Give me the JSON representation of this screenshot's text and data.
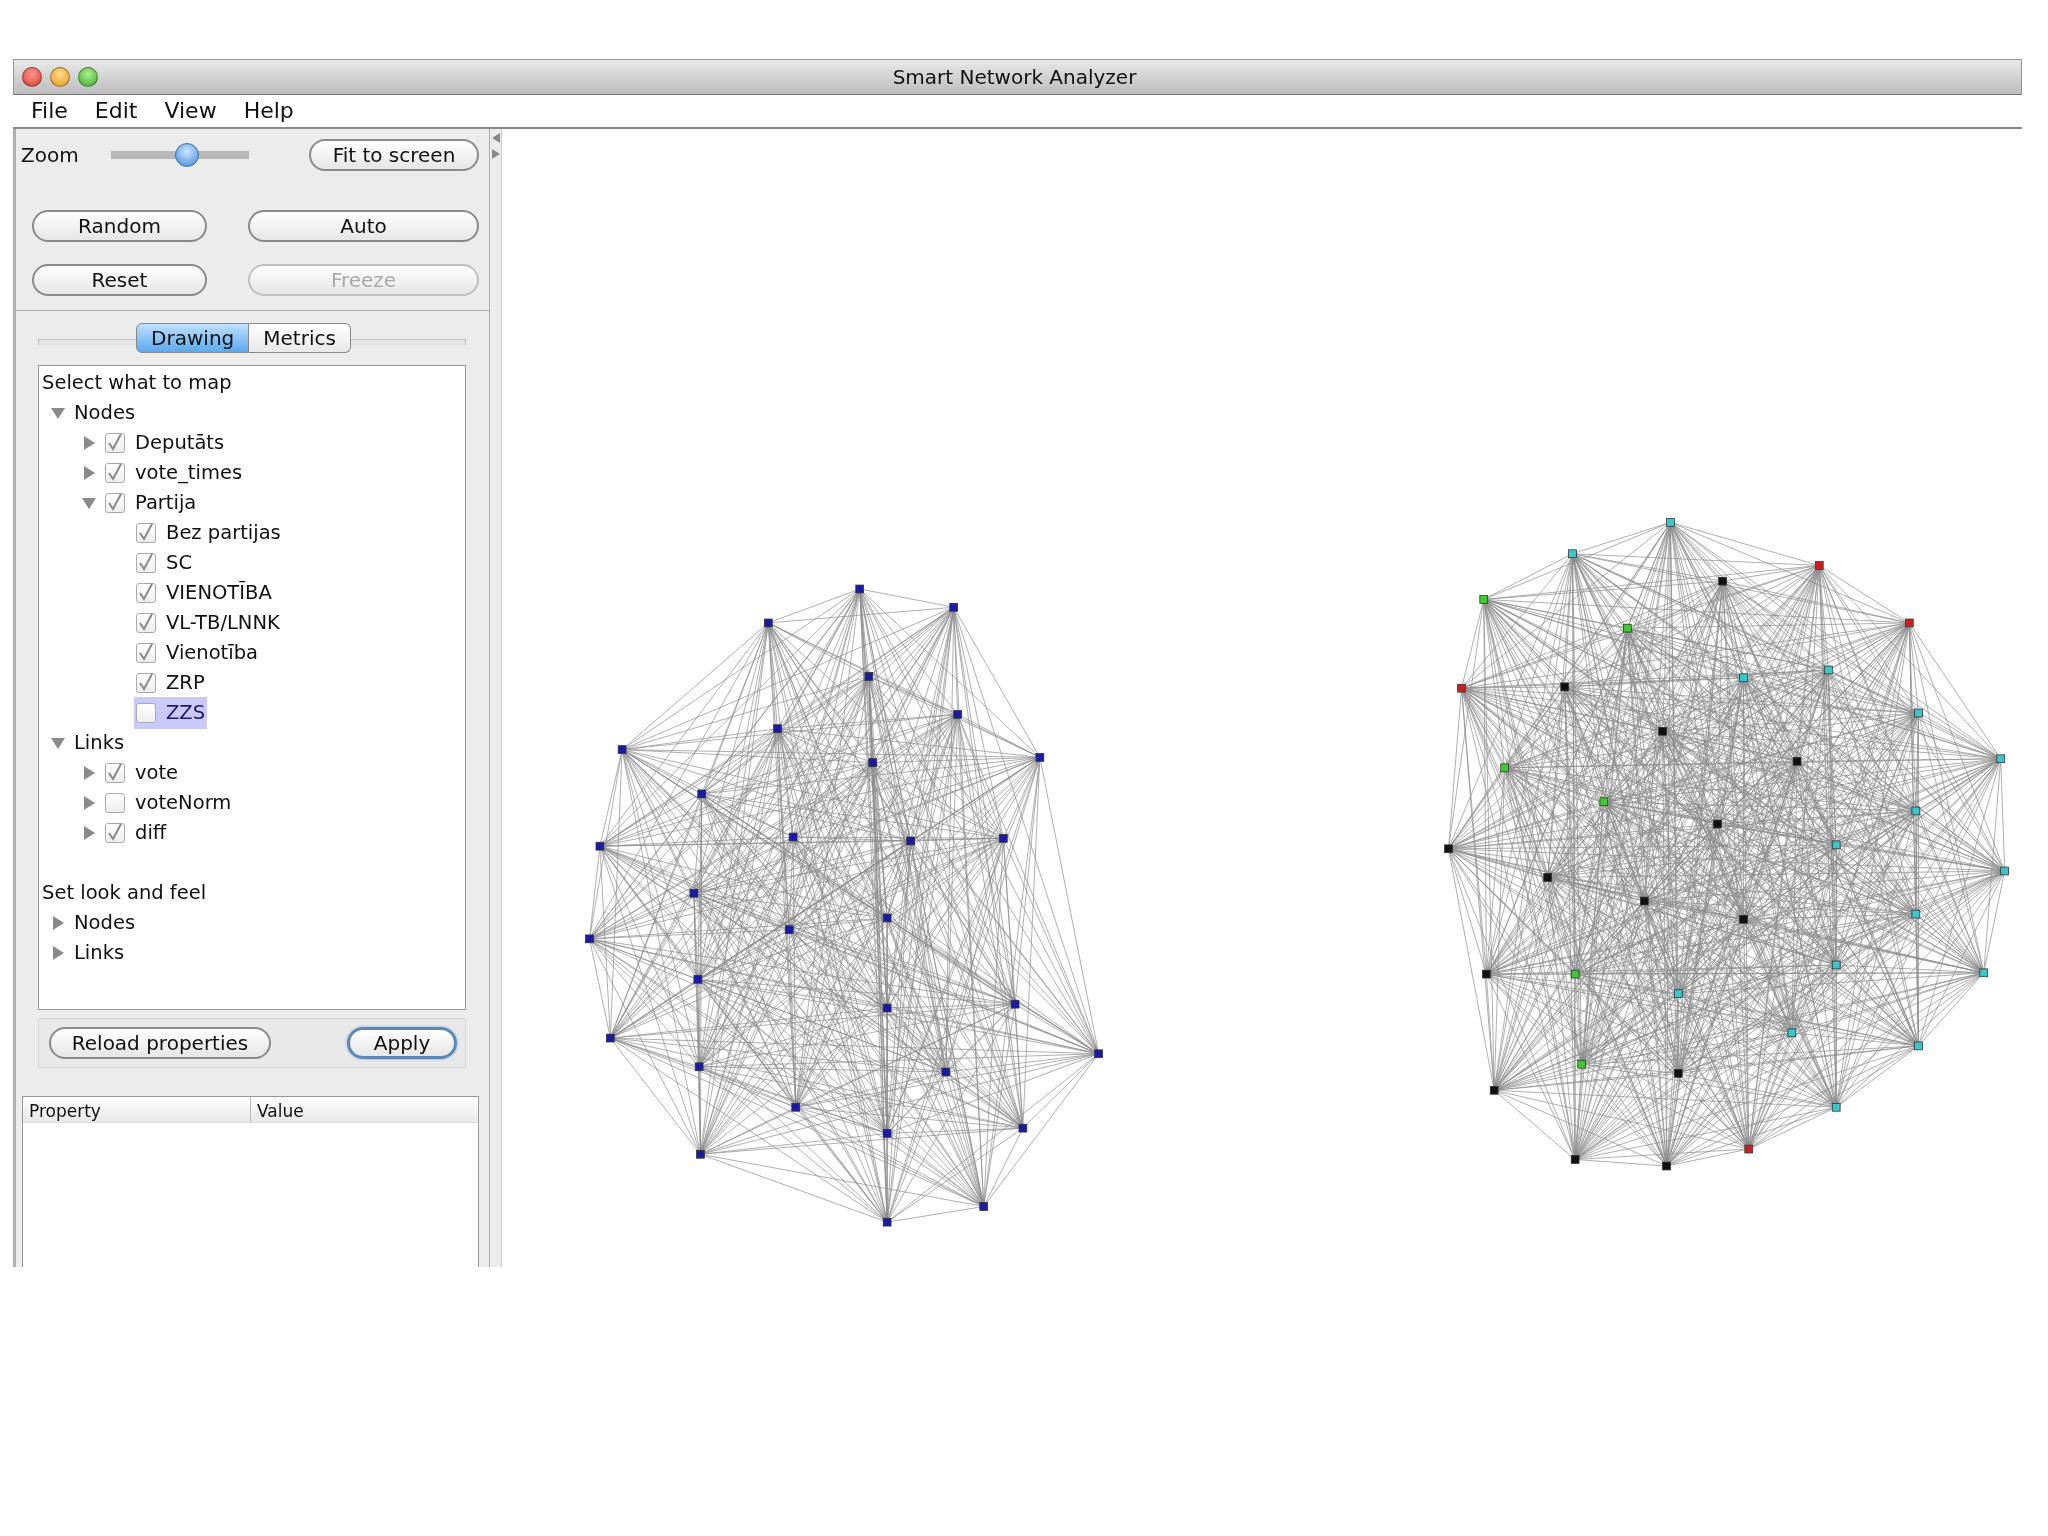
{
  "window": {
    "title": "Smart Network Analyzer"
  },
  "menu": [
    "File",
    "Edit",
    "View",
    "Help"
  ],
  "controls": {
    "zoom_label": "Zoom",
    "zoom": {
      "level": 0.55
    },
    "buttons": [
      {
        "label": "Fit to screen",
        "disabled": false
      },
      {
        "label": "Random",
        "disabled": false
      },
      {
        "label": "Auto",
        "disabled": false
      },
      {
        "label": "Reset",
        "disabled": false
      },
      {
        "label": "Freeze",
        "disabled": true
      }
    ]
  },
  "tabs": [
    {
      "label": "Drawing",
      "selected": true
    },
    {
      "label": "Metrics",
      "selected": false
    }
  ],
  "sections": [
    {
      "heading": "Select what to map",
      "items": [
        {
          "label": "Nodes",
          "expanded": true,
          "children": [
            {
              "label": "Deputāts",
              "expanded": false,
              "checked": true
            },
            {
              "label": "vote_times",
              "expanded": false,
              "checked": true
            },
            {
              "label": "Partija",
              "expanded": true,
              "checked": true,
              "children": [
                {
                  "label": "Bez partijas",
                  "checked": true,
                  "selected": false
                },
                {
                  "label": "SC",
                  "checked": true,
                  "selected": false
                },
                {
                  "label": "VIENOTĪBA",
                  "checked": true,
                  "selected": false
                },
                {
                  "label": "VL-TB/LNNK",
                  "checked": true,
                  "selected": false
                },
                {
                  "label": "Vienotība",
                  "checked": true,
                  "selected": false
                },
                {
                  "label": "ZRP",
                  "checked": true,
                  "selected": false
                },
                {
                  "label": "ZZS",
                  "checked": false,
                  "selected": true
                }
              ]
            }
          ]
        },
        {
          "label": "Links",
          "expanded": true,
          "children": [
            {
              "label": "vote",
              "expanded": false,
              "checked": true
            },
            {
              "label": "voteNorm",
              "expanded": false,
              "checked": false
            },
            {
              "label": "diff",
              "expanded": false,
              "checked": true
            }
          ]
        }
      ]
    },
    {
      "heading": "Set look and feel",
      "items": [
        {
          "label": "Nodes",
          "expanded": false
        },
        {
          "label": "Links",
          "expanded": false
        }
      ]
    }
  ],
  "footer_buttons": [
    {
      "label": "Reload properties",
      "default": false
    },
    {
      "label": "Apply",
      "default": true
    }
  ],
  "property_table": {
    "columns": [
      "Property",
      "Value"
    ]
  }
}
